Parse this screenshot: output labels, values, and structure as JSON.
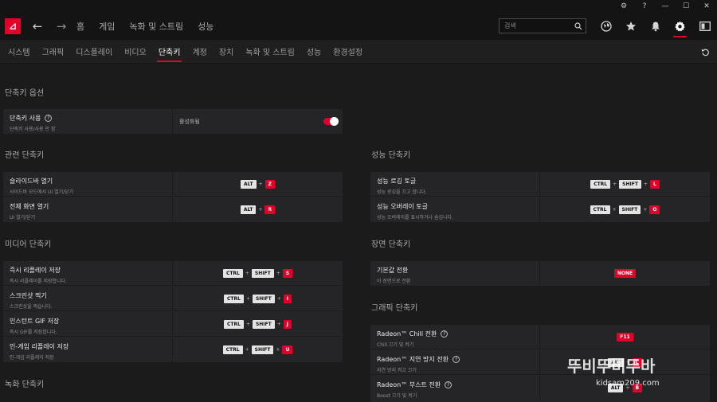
{
  "topnav": {
    "logo": "AMD",
    "links": [
      "홈",
      "게임",
      "녹화 및 스트림",
      "성능"
    ],
    "search_placeholder": "검색",
    "icons": [
      "globe-icon",
      "star-icon",
      "bell-icon",
      "gear-icon",
      "sidebar-icon"
    ],
    "active_icon": "gear-icon"
  },
  "subtabs": {
    "items": [
      "시스템",
      "그래픽",
      "디스플레이",
      "비디오",
      "단축키",
      "계정",
      "장치",
      "녹화 및 스트림",
      "성능",
      "환경설정"
    ],
    "active": "단축키"
  },
  "sections": {
    "options": {
      "title": "단축키 옵션",
      "rows": [
        {
          "label": "단축키 사용",
          "sub": "단축키 사용/사용 안 함",
          "value": "활성화됨",
          "enabled": true
        }
      ]
    },
    "related": {
      "title": "관련 단축키",
      "rows": [
        {
          "label": "슬라이드바 열기",
          "sub": "사이드바 모드에서 UI 열기/닫기",
          "keys": [
            "ALT",
            "Z"
          ]
        },
        {
          "label": "전체 화면 열기",
          "sub": "UI 열기/닫기",
          "keys": [
            "ALT",
            "R"
          ]
        }
      ]
    },
    "media": {
      "title": "미디어 단축키",
      "rows": [
        {
          "label": "즉시 리플레이 저장",
          "sub": "즉시 리플레이를 저장합니다.",
          "keys": [
            "CTRL",
            "SHIFT",
            "S"
          ]
        },
        {
          "label": "스크린샷 찍기",
          "sub": "스크린샷을 찍습니다.",
          "keys": [
            "CTRL",
            "SHIFT",
            "I"
          ]
        },
        {
          "label": "인스턴트 GIF 저장",
          "sub": "즉시 GIF를 저장합니다.",
          "keys": [
            "CTRL",
            "SHIFT",
            "J"
          ]
        },
        {
          "label": "인-게임 리플레이 저장",
          "sub": "인-게임 리플레이 저장",
          "keys": [
            "CTRL",
            "SHIFT",
            "U"
          ]
        }
      ]
    },
    "recording": {
      "title": "녹화 단축키"
    },
    "performance": {
      "title": "성능 단축키",
      "rows": [
        {
          "label": "성능 로깅 토글",
          "sub": "성능 로깅을 끄고 합니다.",
          "keys": [
            "CTRL",
            "SHIFT",
            "L"
          ]
        },
        {
          "label": "성능 오버레이 토글",
          "sub": "성능 오버레이를 표시하거나 숨깁니다.",
          "keys": [
            "CTRL",
            "SHIFT",
            "O"
          ]
        }
      ]
    },
    "scene": {
      "title": "장면 단축키",
      "rows": [
        {
          "label": "기본값 전환",
          "sub": "이 장면으로 전환",
          "keys": [
            "NONE"
          ]
        }
      ]
    },
    "graphics": {
      "title": "그래픽 단축키",
      "rows": [
        {
          "label": "Radeon™ Chill 전환",
          "sub": "Chill 끄기 및 켜기",
          "keys": [
            "F11"
          ],
          "help": true
        },
        {
          "label": "Radeon™ 지연 방지 전환",
          "sub": "지연 방지 켜고 끄기",
          "keys": [
            "ALT",
            "L"
          ],
          "help": true
        },
        {
          "label": "Radeon™ 부스트 전환",
          "sub": "Boost 끄기 및 켜기",
          "keys": [
            "ALT",
            "B"
          ],
          "help": true
        }
      ]
    }
  },
  "watermark": {
    "main": "뚜비뚜비뚜바",
    "sub": "kidsam209.com"
  }
}
